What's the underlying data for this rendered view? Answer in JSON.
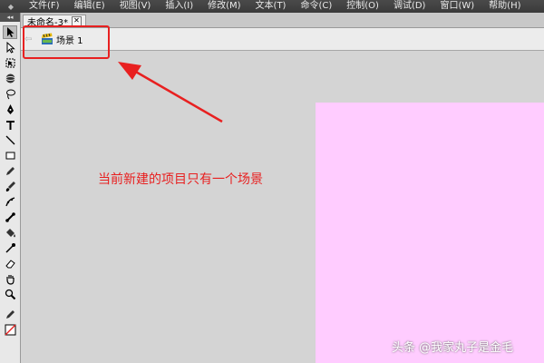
{
  "menubar": {
    "items": [
      "文件(F)",
      "编辑(E)",
      "视图(V)",
      "插入(I)",
      "修改(M)",
      "文本(T)",
      "命令(C)",
      "控制(O)",
      "调试(D)",
      "窗口(W)",
      "帮助(H)"
    ]
  },
  "document_tab": {
    "title": "未命名-3*",
    "close_glyph": "✕"
  },
  "scene_bar": {
    "back_glyph": "⇦",
    "scene_label": "场景 1"
  },
  "annotation": {
    "text": "当前新建的项目只有一个场景",
    "color": "#e82020"
  },
  "watermark": {
    "text": "头条 @我家丸子是金毛"
  },
  "stage": {
    "color": "#ffccff"
  },
  "tools": [
    "selection-arrow-icon",
    "subselection-icon",
    "free-transform-icon",
    "3d-rotation-icon",
    "lasso-icon",
    "pen-icon",
    "text-tool-icon",
    "line-icon",
    "rectangle-icon",
    "pencil-icon",
    "brush-icon",
    "deco-icon",
    "bone-icon",
    "paint-bucket-icon",
    "eyedropper-icon",
    "eraser-icon",
    "hand-icon",
    "zoom-icon",
    "stroke-color-icon",
    "fill-color-icon"
  ]
}
